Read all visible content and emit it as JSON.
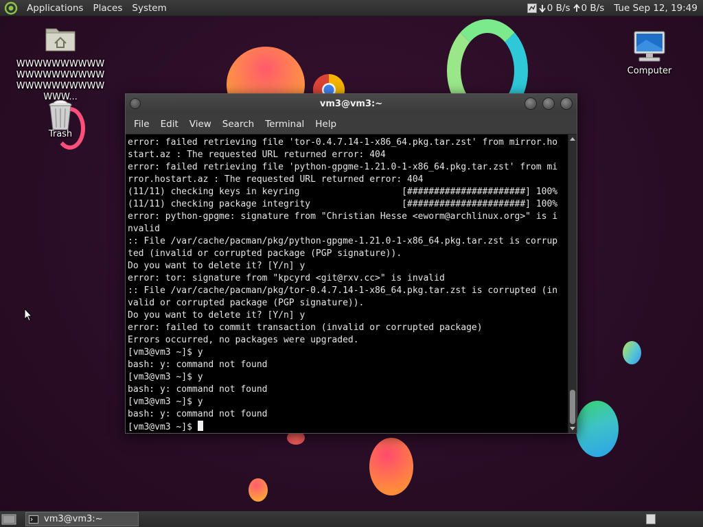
{
  "top_panel": {
    "menus": [
      "Applications",
      "Places",
      "System"
    ],
    "net_down": "0 B/s",
    "net_up": "0 B/s",
    "clock": "Tue Sep 12, 19:49"
  },
  "desktop": {
    "home_label": "WWWWWWWWWWWWWWWWWWWWWWWWWWWWWWWWW...",
    "trash_label": "Trash",
    "computer_label": "Computer"
  },
  "terminal": {
    "title": "vm3@vm3:~",
    "menus": [
      "File",
      "Edit",
      "View",
      "Search",
      "Terminal",
      "Help"
    ],
    "lines": [
      "error: failed retrieving file 'tor-0.4.7.14-1-x86_64.pkg.tar.zst' from mirror.ho",
      "start.az : The requested URL returned error: 404",
      "error: failed retrieving file 'python-gpgme-1.21.0-1-x86_64.pkg.tar.zst' from mi",
      "rror.hostart.az : The requested URL returned error: 404",
      "(11/11) checking keys in keyring                   [######################] 100%",
      "(11/11) checking package integrity                 [######################] 100%",
      "error: python-gpgme: signature from \"Christian Hesse <eworm@archlinux.org>\" is i",
      "nvalid",
      ":: File /var/cache/pacman/pkg/python-gpgme-1.21.0-1-x86_64.pkg.tar.zst is corrup",
      "ted (invalid or corrupted package (PGP signature)).",
      "Do you want to delete it? [Y/n] y",
      "error: tor: signature from \"kpcyrd <git@rxv.cc>\" is invalid",
      ":: File /var/cache/pacman/pkg/tor-0.4.7.14-1-x86_64.pkg.tar.zst is corrupted (in",
      "valid or corrupted package (PGP signature)).",
      "Do you want to delete it? [Y/n] y",
      "error: failed to commit transaction (invalid or corrupted package)",
      "Errors occurred, no packages were upgraded.",
      "[vm3@vm3 ~]$ y",
      "bash: y: command not found",
      "[vm3@vm3 ~]$ y",
      "bash: y: command not found",
      "[vm3@vm3 ~]$ y",
      "bash: y: command not found"
    ],
    "prompt": "[vm3@vm3 ~]$ "
  },
  "bottom_panel": {
    "task_label": "vm3@vm3:~"
  }
}
